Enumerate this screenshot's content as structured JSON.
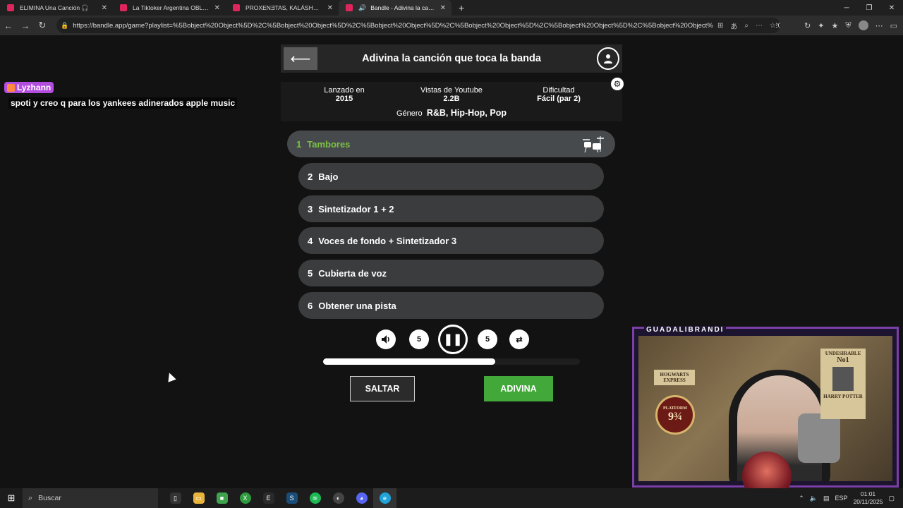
{
  "browser": {
    "tabs": [
      {
        "title": "ELIMINA Una Canción 🎧",
        "favicon_color": "#e0245e",
        "active": false
      },
      {
        "title": "La Tiktoker Argentina OBLIGADA",
        "favicon_color": "#e0245e",
        "active": false
      },
      {
        "title": "PROXENƎTAS, KALÁSHNIKOV y G",
        "favicon_color": "#e0245e",
        "active": false
      },
      {
        "title": "Bandle - Adivina la canción,",
        "favicon_color": "#e0245e",
        "active": true
      }
    ],
    "url": "https://bandle.app/game?playlist=%5Bobject%20Object%5D%2C%5Bobject%20Object%5D%2C%5Bobject%20Object%5D%2C%5Bobject%20Object%5D%2C%5Bobject%20Object%5D%2C%5Bobject%20Object%5D%2C%5Bobject%20Object%5D%2C%5Bobject%20Object%5..."
  },
  "chat": {
    "username": "Lyzhann",
    "message": "spoti y creo q para los yankees adinerados apple music"
  },
  "game": {
    "title": "Adivina la canción que toca la banda",
    "info": {
      "released_label": "Lanzado en",
      "released_value": "2015",
      "views_label": "Vistas de Youtube",
      "views_value": "2.2B",
      "difficulty_label": "Dificultad",
      "difficulty_value": "Fácil (par 2)",
      "genre_label": "Género",
      "genre_value": "R&B, Hip-Hop, Pop"
    },
    "tracks": [
      {
        "num": "1",
        "label": "Tambores",
        "active": true
      },
      {
        "num": "2",
        "label": "Bajo",
        "active": false
      },
      {
        "num": "3",
        "label": "Sintetizador 1 + 2",
        "active": false
      },
      {
        "num": "4",
        "label": "Voces de fondo + Sintetizador 3",
        "active": false
      },
      {
        "num": "5",
        "label": "Cubierta de voz",
        "active": false
      },
      {
        "num": "6",
        "label": "Obtener una pista",
        "active": false
      }
    ],
    "controls": {
      "rewind_label": "5",
      "forward_label": "5"
    },
    "progress": 0.67,
    "skip_label": "SALTAR",
    "guess_label": "ADIVINA"
  },
  "webcam": {
    "channel": "GUADALIBRANDI",
    "poster_top": "HOGWARTS EXPRESS",
    "platform_label": "PLATFORM",
    "platform_number": "9¾",
    "poster_right_1": "UNDESIRABLE",
    "poster_right_2": "No1",
    "poster_right_3": "HARRY POTTER"
  },
  "taskbar": {
    "search_placeholder": "Buscar",
    "lang": "ESP",
    "time": "01:01",
    "date": "20/11/2025"
  },
  "colors": {
    "accent_green": "#43a83a",
    "active_track_text": "#7bc144",
    "twitch_purple": "#b34de0"
  }
}
